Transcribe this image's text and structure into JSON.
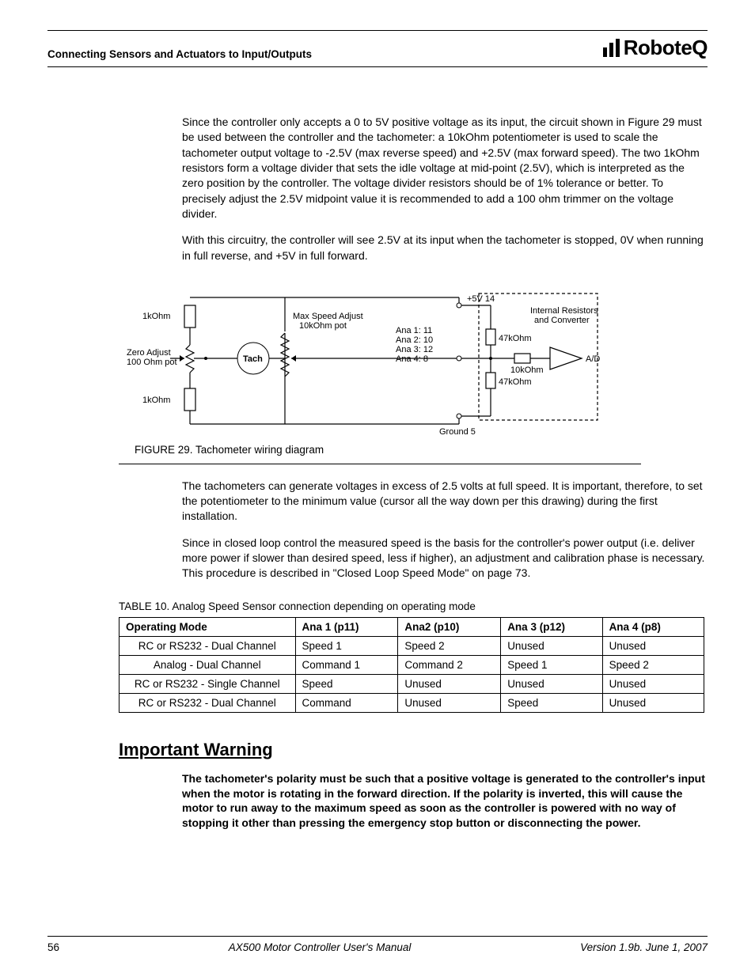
{
  "header": {
    "title": "Connecting Sensors and Actuators to Input/Outputs",
    "brand": "RoboteQ"
  },
  "paragraphs": {
    "intro1": "Since the controller only accepts a 0 to 5V positive voltage as its input, the circuit shown in Figure 29 must be used between the controller and the tachometer: a 10kOhm potentiometer is used to scale the tachometer output voltage to -2.5V (max reverse speed) and +2.5V (max forward speed). The two 1kOhm resistors form a voltage divider that sets the idle voltage at mid-point (2.5V), which is interpreted as the zero position by the controller. The voltage divider resistors should be of 1% tolerance or better. To precisely adjust the 2.5V midpoint value it is recommended to add a 100 ohm trimmer on the voltage divider.",
    "intro2": "With this circuitry, the controller will see 2.5V at its input when the tachometer is stopped, 0V when running in full reverse, and +5V in full forward.",
    "after1": "The tachometers can generate voltages in excess of 2.5 volts at full speed. It is important, therefore, to set the potentiometer to the minimum value (cursor all the way down per this drawing) during the first installation.",
    "after2": "Since in closed loop control the measured speed is the basis for the controller's power output (i.e. deliver more power if slower than desired speed, less if higher), an adjustment and calibration phase is necessary. This procedure is described in \"Closed Loop Speed Mode\" on page 73."
  },
  "figure": {
    "caption_prefix": "FIGURE 29.",
    "caption_text": "Tachometer wiring diagram",
    "labels": {
      "r1k_top": "1kOhm",
      "r1k_bot": "1kOhm",
      "zero1": "Zero Adjust",
      "zero2": "100 Ohm pot",
      "tach": "Tach",
      "max1": "Max Speed Adjust",
      "max2": "10kOhm pot",
      "p5v": "+5V  14",
      "ana1": "Ana 1:  11",
      "ana2": "Ana 2:  10",
      "ana3": "Ana 3:  12",
      "ana4": "Ana 4:    8",
      "gnd": "Ground  5",
      "r47a": "47kOhm",
      "r47b": "47kOhm",
      "r10k": "10kOhm",
      "internal1": "Internal Resistors",
      "internal2": "and Converter",
      "ad": "A/D"
    }
  },
  "table": {
    "title_prefix": "TABLE 10.",
    "title_text": "Analog Speed Sensor connection depending on operating mode",
    "headers": [
      "Operating Mode",
      "Ana 1 (p11)",
      "Ana2 (p10)",
      "Ana 3 (p12)",
      "Ana 4 (p8)"
    ],
    "rows": [
      [
        "RC or RS232 - Dual Channel",
        "Speed 1",
        "Speed 2",
        "Unused",
        "Unused"
      ],
      [
        "Analog - Dual Channel",
        "Command 1",
        "Command 2",
        "Speed 1",
        "Speed 2"
      ],
      [
        "RC or RS232 - Single Channel",
        "Speed",
        "Unused",
        "Unused",
        "Unused"
      ],
      [
        "RC or RS232 - Dual Channel",
        "Command",
        "Unused",
        "Speed",
        "Unused"
      ]
    ]
  },
  "warning": {
    "heading": "Important Warning",
    "body": "The tachometer's polarity must be such that a positive voltage is generated to the controller's input when the motor is rotating in the forward direction. If the polarity is inverted, this will cause the motor to run away to the maximum speed as soon as the controller is powered with no way of stopping it other than pressing the emergency stop button or disconnecting the power."
  },
  "footer": {
    "page": "56",
    "center": "AX500 Motor Controller User's Manual",
    "right": "Version 1.9b. June 1, 2007"
  }
}
